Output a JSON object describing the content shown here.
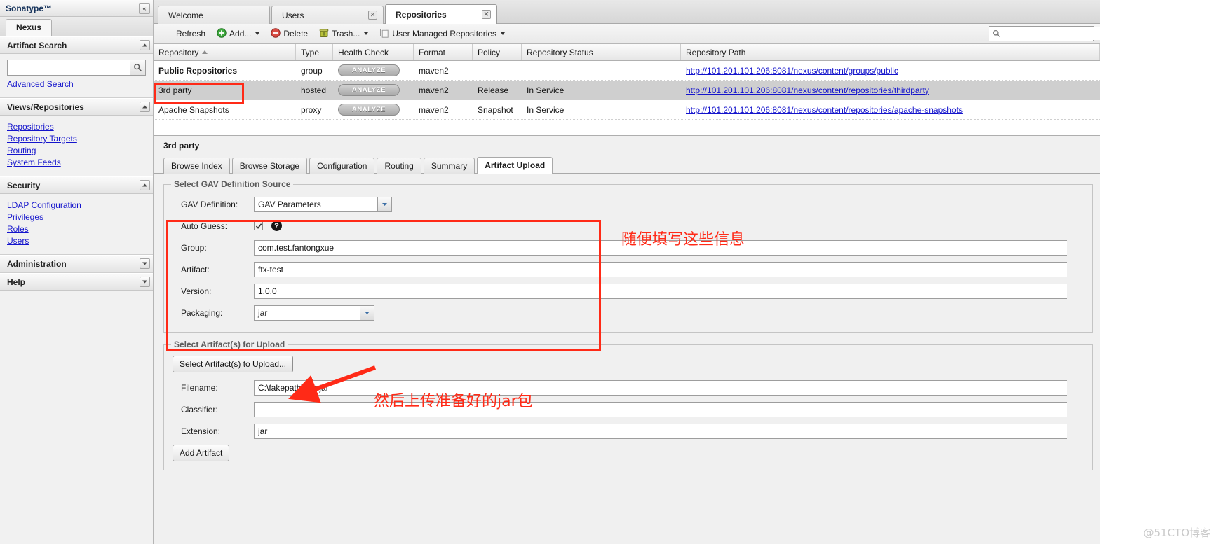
{
  "sidebar": {
    "brand": "Sonatype™",
    "collapse_glyph": "«",
    "nexus_tab": "Nexus",
    "panels": [
      {
        "title": "Artifact Search",
        "toggle": "up",
        "search_value": "",
        "search_placeholder": "",
        "links": [
          "Advanced Search"
        ]
      },
      {
        "title": "Views/Repositories",
        "toggle": "up",
        "links": [
          "Repositories",
          "Repository Targets",
          "Routing",
          "System Feeds"
        ]
      },
      {
        "title": "Security",
        "toggle": "up",
        "links": [
          "LDAP Configuration",
          "Privileges",
          "Roles",
          "Users"
        ]
      },
      {
        "title": "Administration",
        "toggle": "down",
        "links": []
      },
      {
        "title": "Help",
        "toggle": "down",
        "links": []
      }
    ]
  },
  "main_tabs": [
    {
      "label": "Welcome",
      "closable": false,
      "active": false
    },
    {
      "label": "Users",
      "closable": true,
      "active": false
    },
    {
      "label": "Repositories",
      "closable": true,
      "active": true
    }
  ],
  "toolbar": {
    "refresh": "Refresh",
    "add": "Add...",
    "delete": "Delete",
    "trash": "Trash...",
    "filter": "User Managed Repositories",
    "search_value": "",
    "search_placeholder": ""
  },
  "grid": {
    "columns": [
      "Repository",
      "Type",
      "Health Check",
      "Format",
      "Policy",
      "Repository Status",
      "Repository Path"
    ],
    "sort_column": "Repository",
    "sort_direction": "asc",
    "health_check_label": "ANALYZE",
    "rows": [
      {
        "repository": "Public Repositories",
        "type": "group",
        "health_check": "ANALYZE",
        "format": "maven2",
        "policy": "",
        "status": "",
        "path": "http://101.201.101.206:8081/nexus/content/groups/public",
        "selected": false,
        "bold": true
      },
      {
        "repository": "3rd party",
        "type": "hosted",
        "health_check": "ANALYZE",
        "format": "maven2",
        "policy": "Release",
        "status": "In Service",
        "path": "http://101.201.101.206:8081/nexus/content/repositories/thirdparty",
        "selected": true,
        "bold": false
      },
      {
        "repository": "Apache Snapshots",
        "type": "proxy",
        "health_check": "ANALYZE",
        "format": "maven2",
        "policy": "Snapshot",
        "status": "In Service",
        "path": "http://101.201.101.206:8081/nexus/content/repositories/apache-snapshots",
        "selected": false,
        "bold": false
      }
    ]
  },
  "detail": {
    "title": "3rd party",
    "tabs": [
      {
        "label": "Browse Index",
        "active": false
      },
      {
        "label": "Browse Storage",
        "active": false
      },
      {
        "label": "Configuration",
        "active": false
      },
      {
        "label": "Routing",
        "active": false
      },
      {
        "label": "Summary",
        "active": false
      },
      {
        "label": "Artifact Upload",
        "active": true
      }
    ],
    "gav_group": {
      "legend": "Select GAV Definition Source",
      "gav_definition_label": "GAV Definition:",
      "gav_definition_value": "GAV Parameters",
      "auto_guess_label": "Auto Guess:",
      "auto_guess_checked": true,
      "group_label": "Group:",
      "group_value": "com.test.fantongxue",
      "artifact_label": "Artifact:",
      "artifact_value": "ftx-test",
      "version_label": "Version:",
      "version_value": "1.0.0",
      "packaging_label": "Packaging:",
      "packaging_value": "jar"
    },
    "upload_group": {
      "legend": "Select Artifact(s) for Upload",
      "select_button": "Select Artifact(s) to Upload...",
      "filename_label": "Filename:",
      "filename_value": "C:\\fakepath\\test.jar",
      "classifier_label": "Classifier:",
      "classifier_value": "",
      "extension_label": "Extension:",
      "extension_value": "jar",
      "add_artifact_button": "Add Artifact"
    }
  },
  "annotations": {
    "note_gav": "随便填写这些信息",
    "note_upload": "然后上传准备好的jar包",
    "highlight_color": "#ff2a17"
  },
  "watermark": "@51CTO博客"
}
